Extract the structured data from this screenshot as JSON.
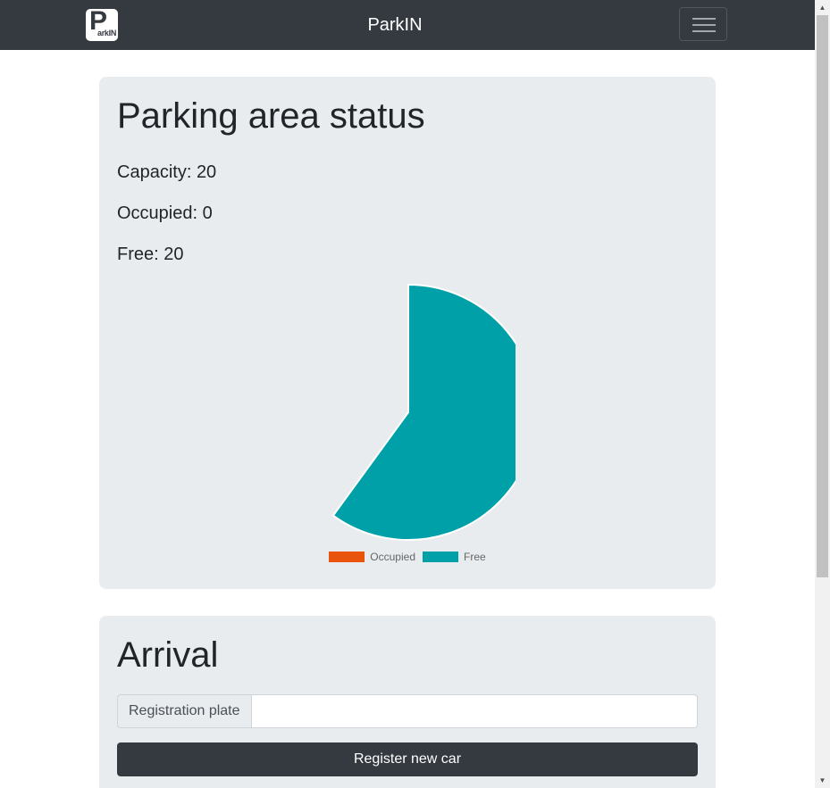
{
  "navbar": {
    "brand": "ParkIN",
    "logo_letter": "P",
    "logo_text": "arkIN",
    "menu_icon": "hamburger-icon"
  },
  "status": {
    "title": "Parking area status",
    "capacity_label": "Capacity:",
    "capacity_value": "20",
    "occupied_label": "Occupied:",
    "occupied_value": "0",
    "free_label": "Free:",
    "free_value": "20"
  },
  "chart_data": {
    "type": "pie",
    "categories": [
      "Occupied",
      "Free"
    ],
    "values": [
      0,
      20
    ],
    "colors": [
      "#e8540c",
      "#00a0a8"
    ],
    "legend_position": "bottom",
    "animation_progress": 0.6
  },
  "arrival": {
    "title": "Arrival",
    "plate_label": "Registration plate",
    "plate_value": "",
    "plate_placeholder": "",
    "register_button": "Register new car"
  },
  "colors": {
    "navbar": "#343a40",
    "card": "#e9ecef",
    "button": "#343a40"
  }
}
